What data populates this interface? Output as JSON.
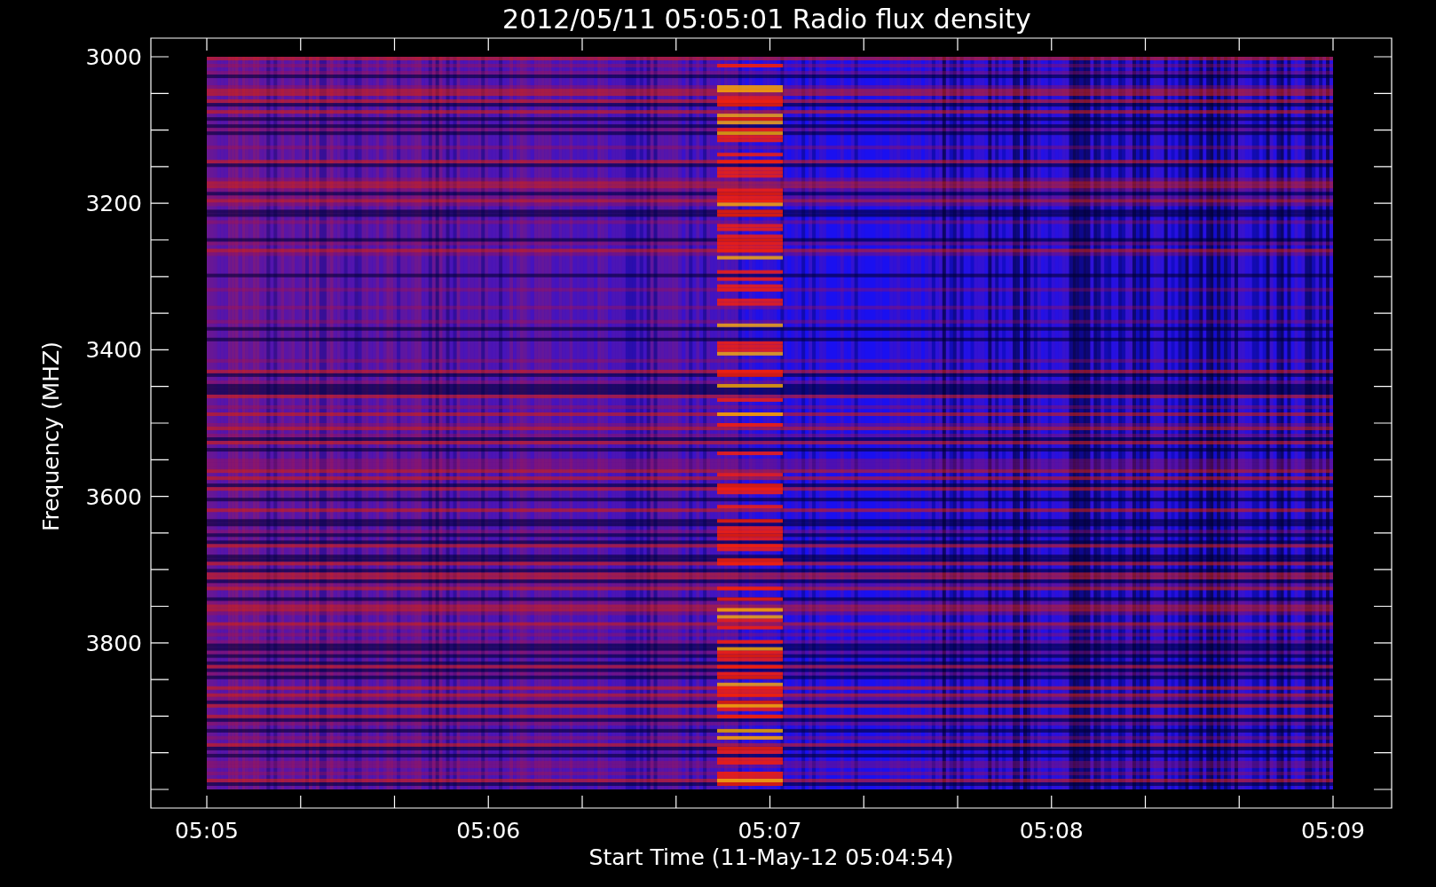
{
  "title": "2012/05/11 05:05:01 Radio flux density",
  "y_axis": {
    "label": "Frequency (MHZ)",
    "ticks": [
      "3000",
      "3200",
      "3400",
      "3600",
      "3800"
    ]
  },
  "x_axis": {
    "label": "Start Time (11-May-12 05:04:54)",
    "ticks": [
      "05:05",
      "05:06",
      "05:07",
      "05:08",
      "05:09"
    ]
  }
}
